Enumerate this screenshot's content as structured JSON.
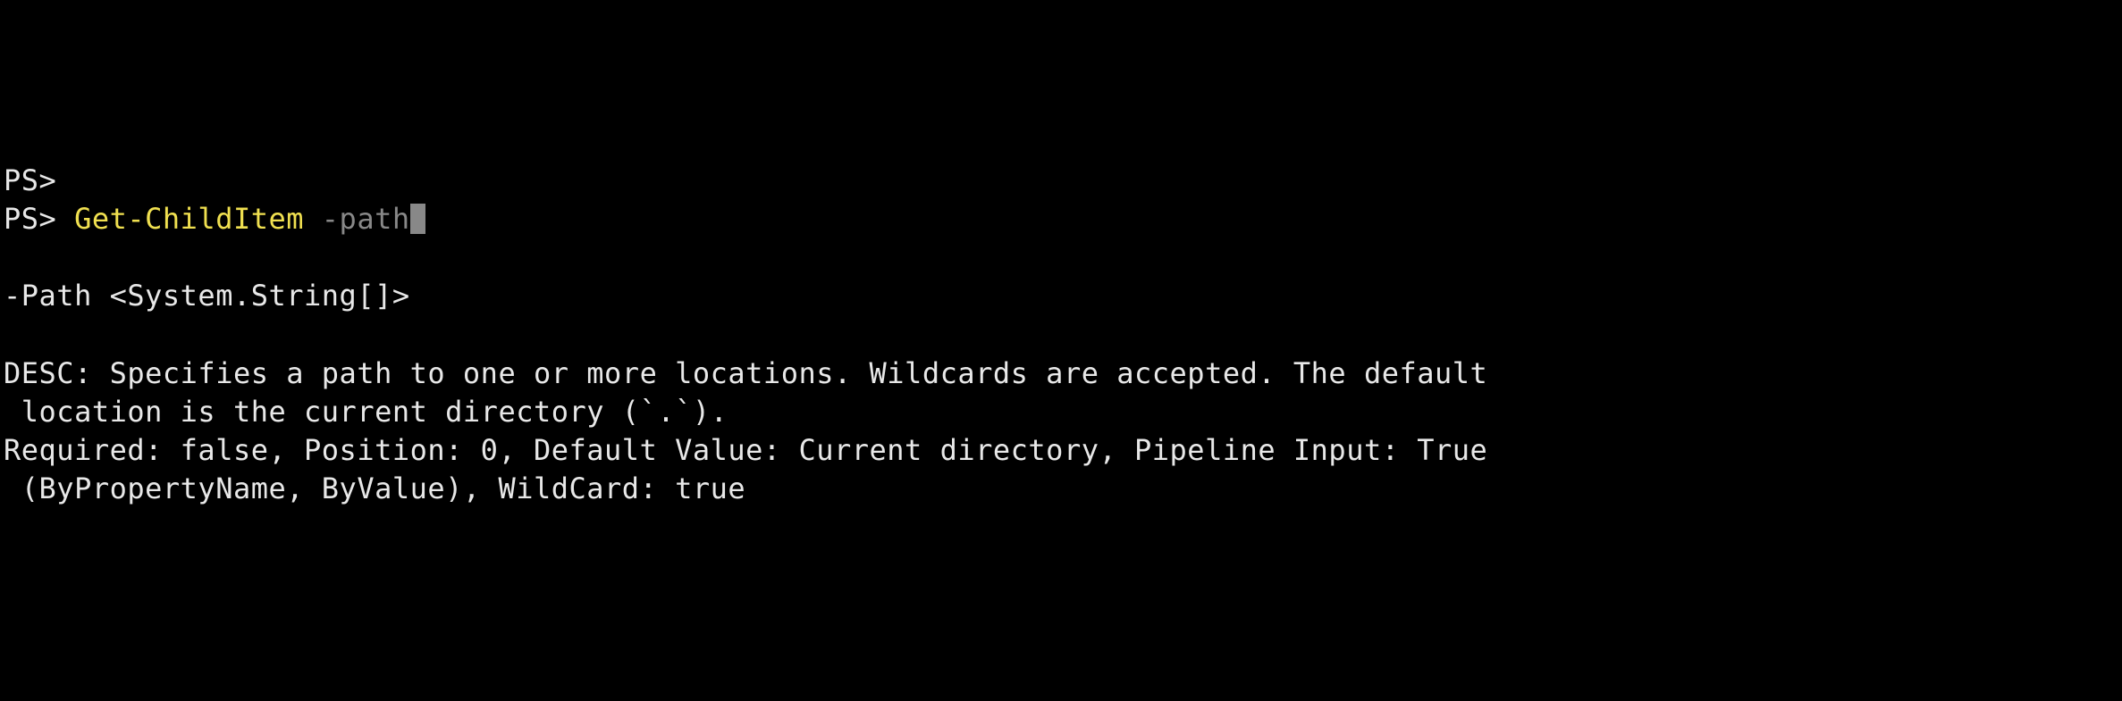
{
  "line1": {
    "prompt": "PS>"
  },
  "line2": {
    "prompt": "PS> ",
    "cmdlet": "Get-ChildItem",
    "space": " ",
    "param": "-path"
  },
  "help": {
    "signature": "-Path <System.String[]>",
    "desc_line1": "DESC: Specifies a path to one or more locations. Wildcards are accepted. The default",
    "desc_line2": " location is the current directory (`.`).",
    "meta_line1": "Required: false, Position: 0, Default Value: Current directory, Pipeline Input: True",
    "meta_line2": " (ByPropertyName, ByValue), WildCard: true"
  }
}
